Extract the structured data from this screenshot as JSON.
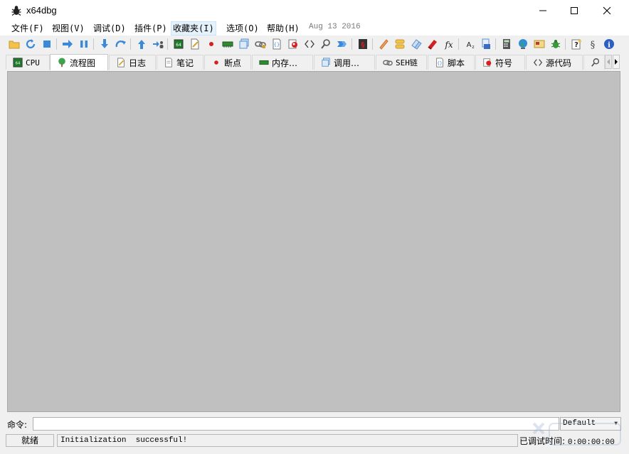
{
  "window": {
    "title": "x64dbg"
  },
  "menu": {
    "items": [
      "文件(F)",
      "视图(V)",
      "调试(D)",
      "插件(P)",
      "收藏夹(I)",
      "选项(O)",
      "帮助(H)"
    ],
    "date": "Aug 13 2016"
  },
  "toolbar": {
    "icons": [
      "open-icon",
      "restart-icon",
      "stop-icon",
      "run-icon",
      "pause-icon",
      "step-into-icon",
      "step-over-icon",
      "execute-till-return-icon",
      "run-to-user-code-icon",
      "cpu-icon",
      "notes-icon",
      "breakpoint-icon",
      "memory-icon",
      "call-stack-icon",
      "seh-icon",
      "script-icon",
      "symbols-icon",
      "source-icon",
      "search-icon",
      "trace-icon",
      "patch-icon",
      "comments-icon",
      "labels-icon",
      "bookmarks-icon",
      "functions-icon",
      "fx-icon",
      "strings-icon",
      "module-icon",
      "calculator-icon",
      "globe-icon",
      "favorites-icon",
      "bug-icon",
      "help-icon",
      "version-icon",
      "info-icon"
    ]
  },
  "tabs": [
    {
      "label": "CPU",
      "icon": "cpu-icon",
      "name": "tab-cpu",
      "active": false
    },
    {
      "label": "流程图",
      "icon": "tree-icon",
      "name": "tab-graph",
      "active": true
    },
    {
      "label": "日志",
      "icon": "log-icon",
      "name": "tab-log",
      "active": false
    },
    {
      "label": "笔记",
      "icon": "notes-icon",
      "name": "tab-notes",
      "active": false
    },
    {
      "label": "断点",
      "icon": "breakpoint-icon",
      "name": "tab-breakpoints",
      "active": false
    },
    {
      "label": "内存…",
      "icon": "memory-icon",
      "name": "tab-memory",
      "active": false
    },
    {
      "label": "调用…",
      "icon": "call-stack-icon",
      "name": "tab-call-stack",
      "active": false
    },
    {
      "label": "SEH链",
      "icon": "seh-icon",
      "name": "tab-seh",
      "active": false
    },
    {
      "label": "脚本",
      "icon": "script-icon",
      "name": "tab-script",
      "active": false
    },
    {
      "label": "符号",
      "icon": "symbols-icon",
      "name": "tab-symbols",
      "active": false
    },
    {
      "label": "源代码",
      "icon": "source-icon",
      "name": "tab-source",
      "active": false
    }
  ],
  "command": {
    "label": "命令:",
    "value": "",
    "mode": "Default"
  },
  "status": {
    "state": "就绪",
    "log": "Initialization  successful!",
    "time_label": "已调试时间:",
    "time_value": "0:00:00:00"
  },
  "colors": {
    "panel": "#c0c0c0",
    "chrome": "#f0f0f0",
    "accent": "#2b6cc4"
  }
}
